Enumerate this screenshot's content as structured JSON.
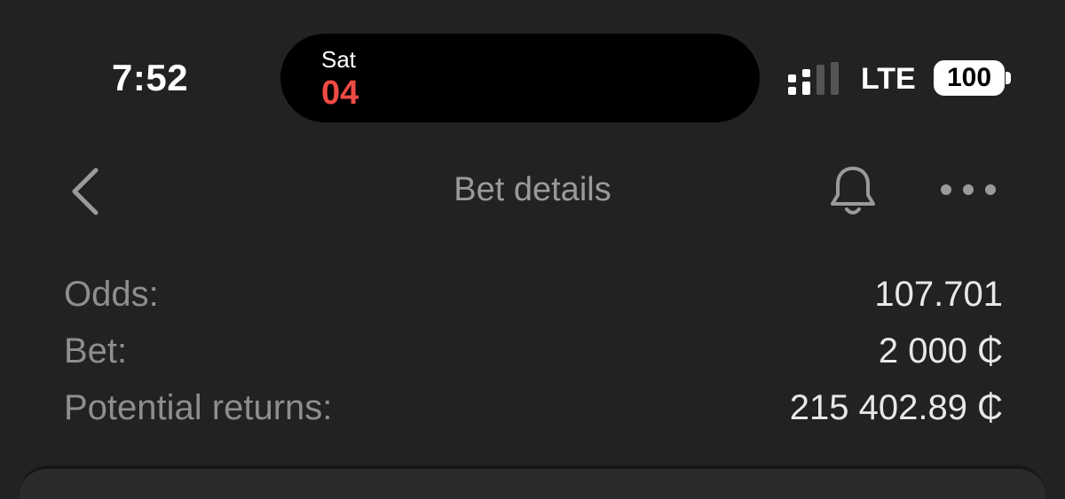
{
  "status_bar": {
    "time": "7:52",
    "island": {
      "day": "Sat",
      "date": "04"
    },
    "network": "LTE",
    "battery": "100",
    "icons": {
      "signal": "cellular-signal-icon",
      "battery": "battery-icon"
    }
  },
  "nav": {
    "title": "Bet details",
    "icons": {
      "back": "chevron-left-icon",
      "bell": "bell-icon",
      "more": "more-horizontal-icon"
    }
  },
  "details": {
    "odds": {
      "label": "Odds:",
      "value": "107.701"
    },
    "bet": {
      "label": "Bet:",
      "value": "2 000 ₵"
    },
    "returns": {
      "label": "Potential returns:",
      "value": "215 402.89 ₵"
    }
  },
  "colors": {
    "background": "#222222",
    "date_accent": "#f04a44",
    "label": "#8e8e8e",
    "value": "#e8e8e8"
  }
}
